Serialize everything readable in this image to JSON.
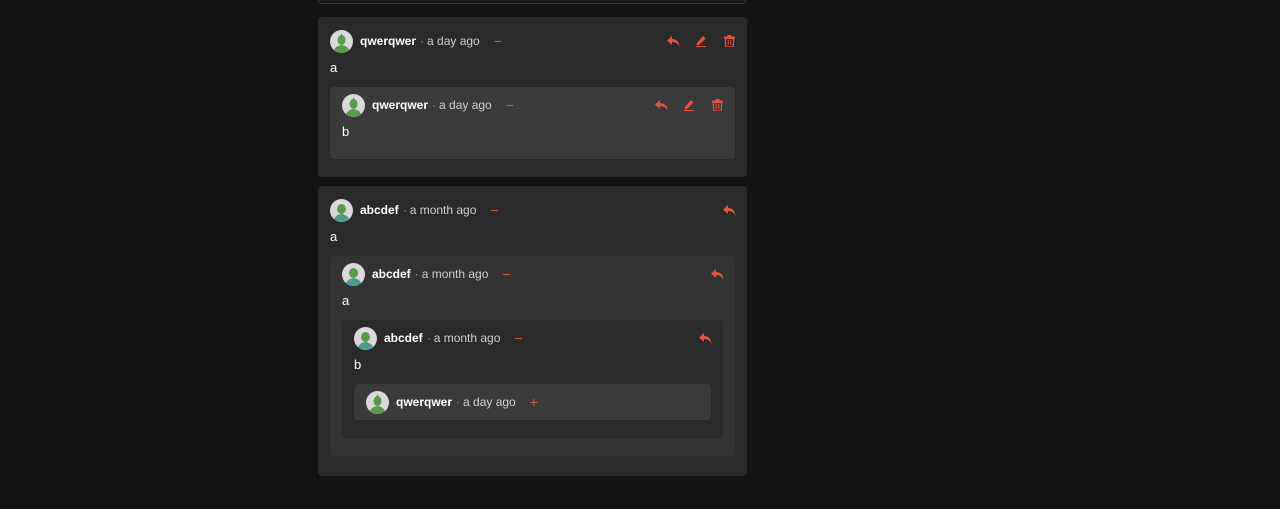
{
  "accent_color": "#e5533c",
  "threads": [
    {
      "comment": {
        "user": "qwerqwer",
        "time": "a day ago",
        "toggle": "−",
        "text": "a"
      },
      "reply": {
        "user": "qwerqwer",
        "time": "a day ago",
        "toggle": "−",
        "text": "b"
      }
    },
    {
      "comment": {
        "user": "abcdef",
        "time": "a month ago",
        "toggle": "−",
        "text": "a"
      },
      "reply": {
        "user": "abcdef",
        "time": "a month ago",
        "toggle": "−",
        "text": "a"
      },
      "reply2": {
        "user": "abcdef",
        "time": "a month ago",
        "toggle": "−",
        "text": "b"
      },
      "reply3": {
        "user": "qwerqwer",
        "time": "a day ago",
        "toggle": "+"
      }
    }
  ],
  "icons": {
    "reply": "reply-icon",
    "edit": "edit-icon",
    "delete": "trash-icon"
  }
}
